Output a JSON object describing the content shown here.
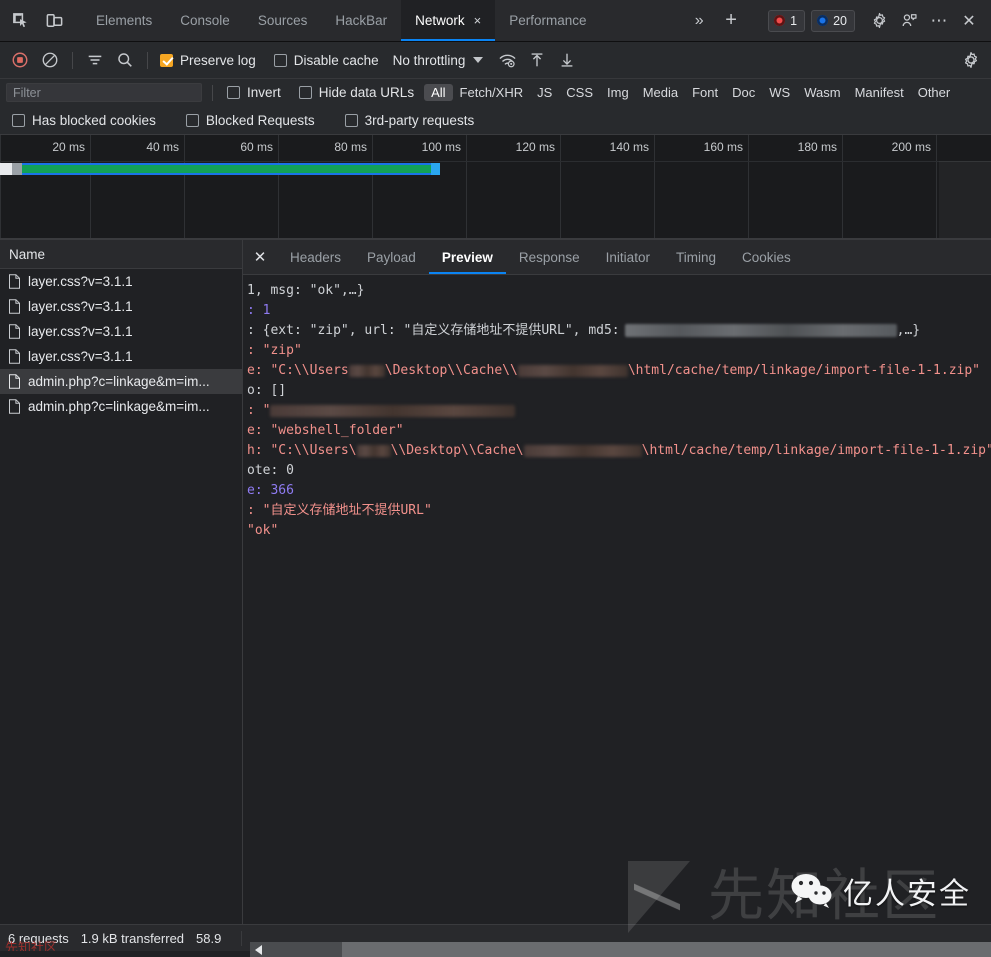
{
  "tabstrip": {
    "left_icons": [
      {
        "name": "inspect-element-icon",
        "title": "Inspect"
      },
      {
        "name": "device-toolbar-icon",
        "title": "Toggle device toolbar"
      }
    ],
    "tabs": [
      {
        "label": "Elements",
        "active": false
      },
      {
        "label": "Console",
        "active": false
      },
      {
        "label": "Sources",
        "active": false
      },
      {
        "label": "HackBar",
        "active": false
      },
      {
        "label": "Network",
        "active": true,
        "closable": true
      },
      {
        "label": "Performance",
        "active": false
      }
    ],
    "close_tab_glyph": "×",
    "more_tabs_glyph": "»",
    "add_tab_glyph": "+",
    "error_count": "1",
    "info_count": "20",
    "settings_icon": "gear-icon",
    "customize_icon": "dock-side-icon",
    "more_glyph": "⋯",
    "close_glyph": "✕"
  },
  "toolbar": {
    "record_title": "Stop recording network log",
    "clear_title": "Clear",
    "filter_title": "Filter",
    "search_title": "Search",
    "preserve_log": {
      "label": "Preserve log",
      "checked": true
    },
    "disable_cache": {
      "label": "Disable cache",
      "checked": false
    },
    "throttling": {
      "value": "No throttling"
    },
    "network_conditions_title": "Network conditions",
    "import_title": "Import HAR file",
    "export_title": "Export HAR file",
    "settings_title": "Network settings"
  },
  "filterbar": {
    "filter_placeholder": "Filter",
    "filter_value": "",
    "invert": {
      "label": "Invert",
      "checked": false
    },
    "hide_data_urls": {
      "label": "Hide data URLs",
      "checked": false
    },
    "types": [
      {
        "label": "All",
        "active": true
      },
      {
        "label": "Fetch/XHR",
        "active": false
      },
      {
        "label": "JS",
        "active": false
      },
      {
        "label": "CSS",
        "active": false
      },
      {
        "label": "Img",
        "active": false
      },
      {
        "label": "Media",
        "active": false
      },
      {
        "label": "Font",
        "active": false
      },
      {
        "label": "Doc",
        "active": false
      },
      {
        "label": "WS",
        "active": false
      },
      {
        "label": "Wasm",
        "active": false
      },
      {
        "label": "Manifest",
        "active": false
      },
      {
        "label": "Other",
        "active": false
      }
    ],
    "blocked": [
      {
        "label": "Has blocked cookies",
        "checked": false
      },
      {
        "label": "Blocked Requests",
        "checked": false
      },
      {
        "label": "3rd-party requests",
        "checked": false
      }
    ]
  },
  "overview": {
    "ticks": [
      "20 ms",
      "40 ms",
      "60 ms",
      "80 ms",
      "100 ms",
      "120 ms",
      "140 ms",
      "160 ms",
      "180 ms",
      "200 ms"
    ],
    "bars": [
      {
        "kind": "wide",
        "left_pct": 0.2,
        "width_pct": 44.3,
        "wait_color": "#1a73e8",
        "download_color": "#12a157"
      },
      {
        "kind": "thin",
        "left_pct": 47.5,
        "width_pct": 47.0,
        "wait_color": "#9aa0a6",
        "download_color": "#12a157"
      }
    ]
  },
  "requests": {
    "column_header": "Name",
    "rows": [
      {
        "name": "layer.css?v=3.1.1",
        "selected": false
      },
      {
        "name": "layer.css?v=3.1.1",
        "selected": false
      },
      {
        "name": "layer.css?v=3.1.1",
        "selected": false
      },
      {
        "name": "layer.css?v=3.1.1",
        "selected": false
      },
      {
        "name": "admin.php?c=linkage&m=im...",
        "selected": true
      },
      {
        "name": "admin.php?c=linkage&m=im...",
        "selected": false
      }
    ]
  },
  "detail": {
    "close_glyph": "✕",
    "tabs": [
      {
        "label": "Headers",
        "active": false
      },
      {
        "label": "Payload",
        "active": false
      },
      {
        "label": "Preview",
        "active": true
      },
      {
        "label": "Response",
        "active": false
      },
      {
        "label": "Initiator",
        "active": false
      },
      {
        "label": "Timing",
        "active": false
      },
      {
        "label": "Cookies",
        "active": false
      }
    ],
    "preview_lines": [
      {
        "id": "l0",
        "text": "1, msg: \"ok\",…}"
      },
      {
        "id": "l1",
        "text": ": 1"
      },
      {
        "id": "l2",
        "text": ": {ext: \"zip\", url: \"自定义存储地址不提供URL\", md5:"
      },
      {
        "id": "l2b",
        "text": ",…}"
      },
      {
        "id": "l3",
        "text": ": \"zip\""
      },
      {
        "id": "l4a",
        "text": "e: \"C:\\\\Users"
      },
      {
        "id": "l4b",
        "text": "\\Desktop\\\\Cache\\\\"
      },
      {
        "id": "l4c",
        "text": "\\html/cache/temp/linkage/import-file-1-1.zip\""
      },
      {
        "id": "l5",
        "text": "o: []"
      },
      {
        "id": "l6",
        "text": ": \""
      },
      {
        "id": "l7",
        "text": "e: \"webshell_folder\""
      },
      {
        "id": "l8a",
        "text": "h: \"C:\\\\Users\\"
      },
      {
        "id": "l8b",
        "text": "\\\\Desktop\\\\Cache\\"
      },
      {
        "id": "l8c",
        "text": "\\html/cache/temp/linkage/import-file-1-1.zip\""
      },
      {
        "id": "l9",
        "text": "ote: 0"
      },
      {
        "id": "l10",
        "text": "e: 366"
      },
      {
        "id": "l11",
        "text": ": \"自定义存储地址不提供URL\""
      },
      {
        "id": "l12",
        "text": "\"ok\""
      }
    ],
    "values": {
      "code": "1",
      "msg": "ok",
      "ext": "zip",
      "url": "自定义存储地址不提供URL",
      "type": "zip",
      "file_path": "C:\\\\Users\\...\\Desktop\\\\Cache\\\\...\\html/cache/temp/linkage/import-file-1-1.zip",
      "info": "[]",
      "name": "webshell_folder",
      "path": "C:\\\\Users\\...\\Desktop\\\\Cache\\...\\html/cache/temp/linkage/import-file-1-1.zip",
      "remote": "0",
      "size": "366",
      "status_text": "ok"
    }
  },
  "statusbar": {
    "requests": "6 requests",
    "transferred": "1.9 kB transferred",
    "resources": "58.9",
    "leak_text": "先知社区"
  },
  "watermarks": {
    "primary": "先知社区",
    "secondary": "亿人安全"
  },
  "colors": {
    "accent": "#0b84f3",
    "checkbox_checked": "#f5a623",
    "string": "#f2918c",
    "number": "#8f7bf2",
    "download_bar": "#12a157",
    "wait_bar": "#1a73e8",
    "error": "#f04b4b",
    "info": "#1a73e8"
  }
}
